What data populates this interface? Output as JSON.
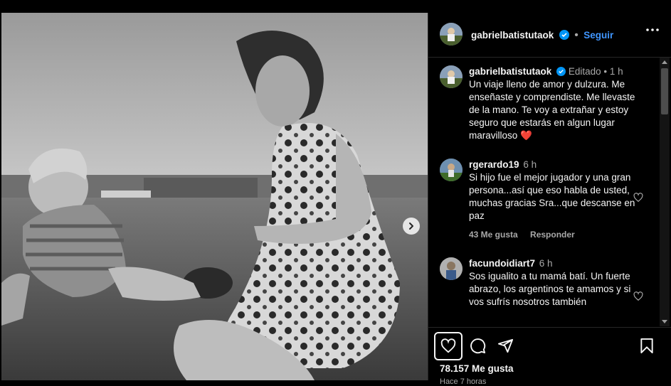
{
  "post": {
    "image_alt": "black-and-white photo of a woman and a child sitting on grass",
    "next_icon": "chevron-right-icon"
  },
  "header": {
    "username": "gabrielbatistutaok",
    "follow_label": "Seguir",
    "more_icon": "more-horizontal-icon",
    "verified_color": "#0095f6"
  },
  "caption": {
    "username": "gabrielbatistutaok",
    "edited": "Editado",
    "separator": "•",
    "time": "1 h",
    "text": "Un viaje lleno de amor y dulzura. Me enseñaste y comprendiste. Me llevaste de la mano. Te voy a extrañar y estoy seguro que estarás en algun lugar maravilloso",
    "emoji": "❤️"
  },
  "comments": [
    {
      "username": "rgerardo19",
      "time": "6 h",
      "text": "Si hijo fue el mejor jugador y una gran persona...así que eso habla de usted, muchas gracias Sra...que descanse en paz",
      "likes": "43 Me gusta",
      "reply": "Responder"
    },
    {
      "username": "facundoidiart7",
      "time": "6 h",
      "text": "Sos igualito a tu mamá batí. Un fuerte abrazo, los argentinos te amamos y si vos sufrís nosotros también"
    }
  ],
  "footer": {
    "likes": "78.157 Me gusta",
    "time": "Hace 7 horas"
  },
  "colors": {
    "accent": "#4096ff",
    "heart": "#ed4956",
    "muted": "#a8a8a8"
  }
}
